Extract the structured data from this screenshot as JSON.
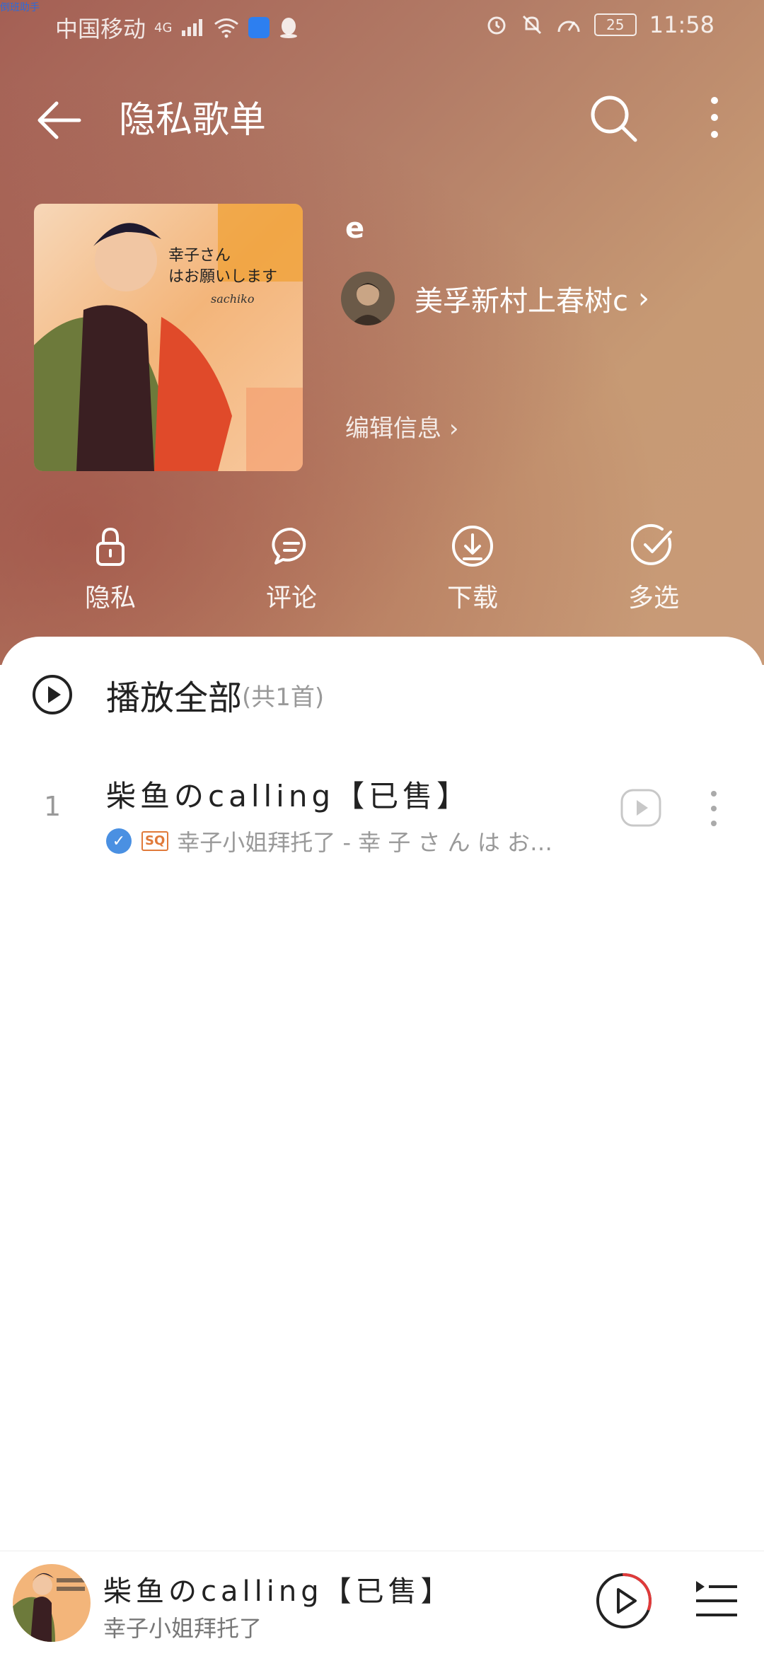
{
  "status_bar": {
    "carrier": "中国移动",
    "network": "4G",
    "battery": "25",
    "time": "11:58",
    "corner_badge": "倒班助手"
  },
  "header": {
    "back_icon": "arrow-left-icon",
    "title": "隐私歌单",
    "search_icon": "search-icon",
    "more_icon": "more-vertical-icon"
  },
  "playlist": {
    "name": "e",
    "creator": "美孚新村上春树c",
    "edit_label": "编辑信息",
    "cover_text_line1": "幸子さん",
    "cover_text_line2": "はお願いします",
    "cover_signature": "sachiko"
  },
  "actions": [
    {
      "icon": "lock-icon",
      "label": "隐私"
    },
    {
      "icon": "comment-icon",
      "label": "评论"
    },
    {
      "icon": "download-icon",
      "label": "下载"
    },
    {
      "icon": "multi-select-icon",
      "label": "多选"
    }
  ],
  "play_all": {
    "label": "播放全部",
    "count": "(共1首)"
  },
  "songs": [
    {
      "index": "1",
      "title": "柴鱼のcalling【已售】",
      "badge": "SQ",
      "subtitle": "幸子小姐拜托了 - 幸 子 さ ん は お…"
    }
  ],
  "now_playing": {
    "title": "柴鱼のcalling【已售】",
    "artist": "幸子小姐拜托了",
    "playback_progress": 0.3
  },
  "colors": {
    "hero_start": "#a45f54",
    "hero_end": "#c89a78",
    "accent_red": "#e03a3a",
    "sq_orange": "#e07a3a",
    "vip_blue": "#4a90e2"
  }
}
